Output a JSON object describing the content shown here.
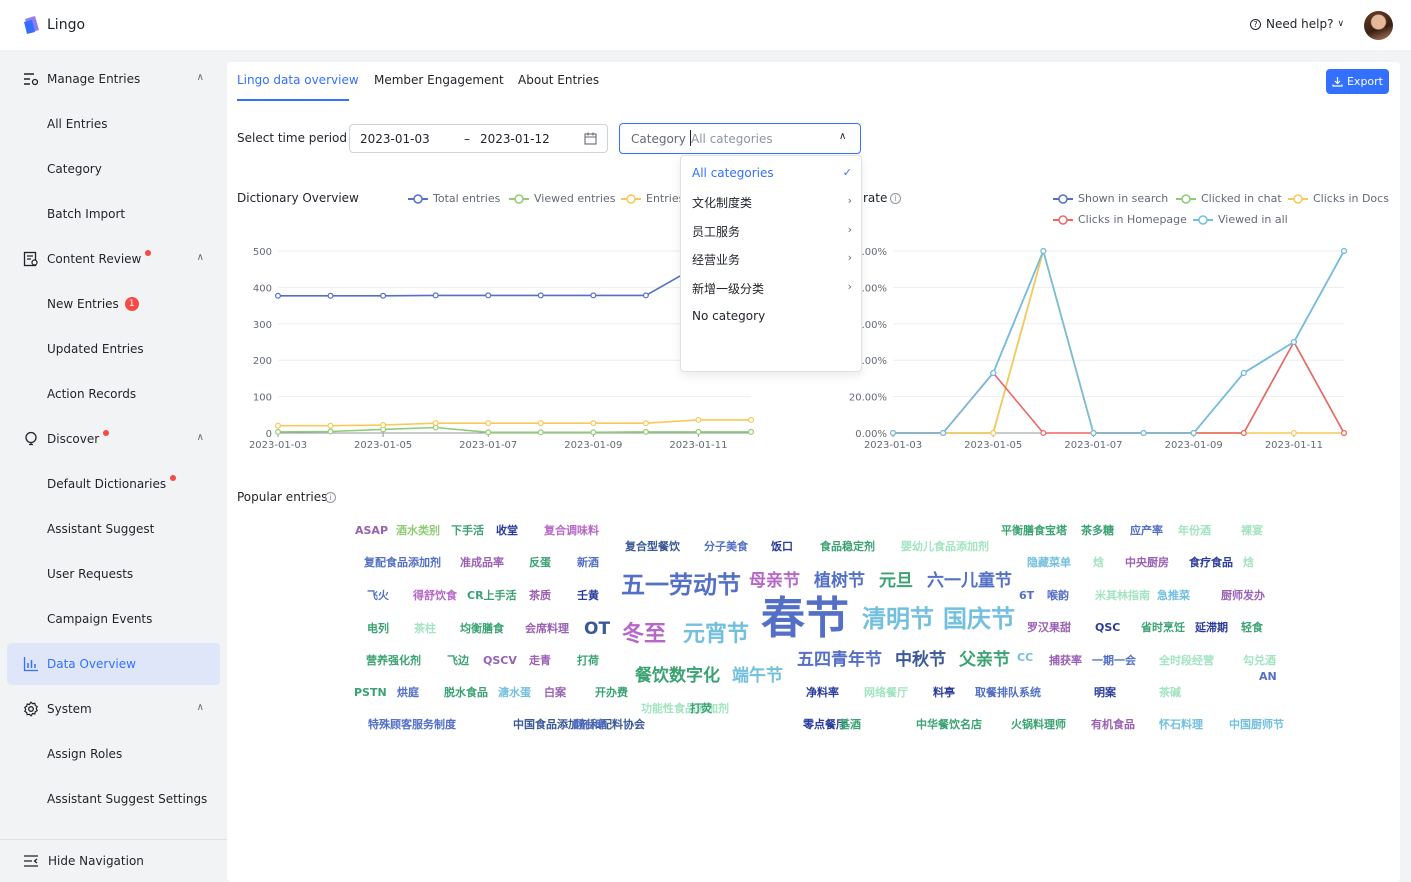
{
  "app": {
    "name": "Lingo",
    "help": "Need help?",
    "avatar": "user-avatar"
  },
  "sidebar": {
    "groups": [
      {
        "label": "Manage Entries",
        "icon": "list-settings-icon",
        "items": [
          "All Entries",
          "Category",
          "Batch Import"
        ]
      },
      {
        "label": "Content Review",
        "icon": "review-icon",
        "items": [
          "New Entries",
          "Updated Entries",
          "Action Records"
        ],
        "new_badge": "1"
      },
      {
        "label": "Discover",
        "icon": "bulb-icon",
        "items": [
          "Default Dictionaries",
          "Assistant Suggest",
          "User Requests",
          "Campaign Events",
          "Data Overview"
        ]
      },
      {
        "label": "System",
        "icon": "gear-icon",
        "items": [
          "Assign Roles",
          "Assistant Suggest Settings"
        ]
      }
    ],
    "hide_nav": "Hide Navigation"
  },
  "tabs": [
    "Lingo data overview",
    "Member Engagement",
    "About Entries"
  ],
  "export_label": "Export",
  "filters": {
    "time_label": "Select time period",
    "start_date": "2023-01-03",
    "end_date": "2023-01-12",
    "date_sep": "–",
    "category_label": "Category",
    "category_placeholder": "All categories"
  },
  "dropdown": {
    "options": [
      "All categories",
      "文化制度类",
      "员工服务",
      "经营业务",
      "新增一级分类",
      "No category"
    ]
  },
  "dictionary_chart": {
    "title": "Dictionary Overview",
    "legend": [
      "Total entries",
      "Viewed entries",
      "Entries"
    ]
  },
  "rate_chart": {
    "title_fragment": "rate",
    "legend": [
      "Shown in search",
      "Clicked in chat",
      "Clicks in Docs",
      "Clicks in Homepage",
      "Viewed in all"
    ]
  },
  "popular": {
    "title": "Popular entries"
  },
  "chart_data": [
    {
      "type": "line",
      "title": "Dictionary Overview",
      "x": [
        "2023-01-03",
        "2023-01-04",
        "2023-01-05",
        "2023-01-06",
        "2023-01-07",
        "2023-01-08",
        "2023-01-09",
        "2023-01-10",
        "2023-01-11",
        "2023-01-12"
      ],
      "x_ticks": [
        "2023-01-03",
        "2023-01-05",
        "2023-01-07",
        "2023-01-09",
        "2023-01-11"
      ],
      "y_ticks": [
        "0",
        "100",
        "200",
        "300",
        "400",
        "500"
      ],
      "ylim": [
        0,
        500
      ],
      "series": [
        {
          "name": "Total entries",
          "color": "#5470c6",
          "values": [
            377,
            377,
            377,
            378,
            378,
            378,
            378,
            378,
            460,
            null
          ]
        },
        {
          "name": "Viewed entries",
          "color": "#91cc75",
          "values": [
            3,
            4,
            10,
            15,
            2,
            2,
            2,
            3,
            3,
            3
          ]
        },
        {
          "name": "Entries",
          "color": "#fac858",
          "values": [
            20,
            20,
            22,
            27,
            27,
            27,
            27,
            27,
            36,
            36
          ]
        }
      ]
    },
    {
      "type": "line",
      "title": "rate",
      "x": [
        "2023-01-03",
        "2023-01-04",
        "2023-01-05",
        "2023-01-06",
        "2023-01-07",
        "2023-01-08",
        "2023-01-09",
        "2023-01-10",
        "2023-01-11",
        "2023-01-12"
      ],
      "x_ticks": [
        "2023-01-03",
        "2023-01-05",
        "2023-01-07",
        "2023-01-09",
        "2023-01-11"
      ],
      "y_ticks": [
        "0.00%",
        "20.00%",
        "40.00%",
        "60.00%",
        "80.00%",
        "100.00%"
      ],
      "ylim": [
        0,
        100
      ],
      "series": [
        {
          "name": "Shown in search",
          "color": "#5470c6",
          "values": [
            0,
            0,
            33,
            100,
            0,
            0,
            0,
            33,
            50,
            100
          ]
        },
        {
          "name": "Clicked in chat",
          "color": "#91cc75",
          "values": [
            0,
            0,
            0,
            100,
            0,
            0,
            0,
            0,
            50,
            0
          ]
        },
        {
          "name": "Clicks in Docs",
          "color": "#fac858",
          "values": [
            0,
            0,
            0,
            100,
            0,
            0,
            0,
            0,
            0,
            0
          ]
        },
        {
          "name": "Clicks in Homepage",
          "color": "#ee6666",
          "values": [
            0,
            0,
            33,
            0,
            0,
            0,
            0,
            0,
            50,
            0
          ]
        },
        {
          "name": "Viewed in all",
          "color": "#73c0de",
          "values": [
            0,
            0,
            33,
            100,
            0,
            0,
            0,
            33,
            50,
            100
          ]
        }
      ]
    }
  ],
  "words": [
    [
      "ASAP",
      "#9a60b4"
    ],
    [
      "酒水类别",
      "#91cc75"
    ],
    [
      "下手活",
      "#3ba272"
    ],
    [
      "收堂",
      "#2b3b9c"
    ],
    [
      "复合调味料",
      "#b667c8"
    ],
    [
      "复合型餐饮",
      "#3b5998"
    ],
    [
      "分子美食",
      "#5470c6"
    ],
    [
      "饭口",
      "#2b3b9c"
    ],
    [
      "食品稳定剂",
      "#3ba272"
    ],
    [
      "婴幼儿食品添加剂",
      "#a3e4c1"
    ],
    [
      "平衡膳食宝塔",
      "#3ba272"
    ],
    [
      "茶多糖",
      "#3ba272"
    ],
    [
      "应产率",
      "#5470c6"
    ],
    [
      "年份酒",
      "#a3e4c1"
    ],
    [
      "裸宴",
      "#a3e4c1"
    ],
    [
      "复配食品添加剂",
      "#5470c6"
    ],
    [
      "准成品率",
      "#9a60b4"
    ],
    [
      "反蛋",
      "#3ba272"
    ],
    [
      "新酒",
      "#5470c6"
    ],
    [
      "隐藏菜单",
      "#73c0de"
    ],
    [
      "焓",
      "#a3e4c1"
    ],
    [
      "中央厨房",
      "#9a60b4"
    ],
    [
      "食疗食品",
      "#2b3b9c"
    ],
    [
      "焓",
      "#a3e4c1"
    ],
    [
      "五一劳动节",
      "#5470c6"
    ],
    [
      "母亲节",
      "#b667c8"
    ],
    [
      "植树节",
      "#5470c6"
    ],
    [
      "元旦",
      "#3ba272"
    ],
    [
      "六一儿童节",
      "#5470c6"
    ],
    [
      "飞火",
      "#5470c6"
    ],
    [
      "得舒饮食",
      "#b667c8"
    ],
    [
      "CR上手活",
      "#3ba272"
    ],
    [
      "茶质",
      "#9a60b4"
    ],
    [
      "壬黄",
      "#2b3b9c"
    ],
    [
      "6T",
      "#5470c6"
    ],
    [
      "喉韵",
      "#5470c6"
    ],
    [
      "米其林指南",
      "#a3e4c1"
    ],
    [
      "急推菜",
      "#73c0de"
    ],
    [
      "厨师发办",
      "#9a60b4"
    ],
    [
      "春节",
      "#5470c6"
    ],
    [
      "清明节",
      "#73c0de"
    ],
    [
      "国庆节",
      "#73c0de"
    ],
    [
      "冬至",
      "#b667c8"
    ],
    [
      "元宵节",
      "#73c0de"
    ],
    [
      "OT",
      "#3b5998"
    ],
    [
      "电列",
      "#3ba272"
    ],
    [
      "茶柱",
      "#a3e4c1"
    ],
    [
      "均衡膳食",
      "#3ba272"
    ],
    [
      "会席料理",
      "#9a60b4"
    ],
    [
      "罗汉果甜",
      "#9a60b4"
    ],
    [
      "QSC",
      "#2b3b9c"
    ],
    [
      "省时烹饪",
      "#3ba272"
    ],
    [
      "延滞期",
      "#2b3b9c"
    ],
    [
      "轻食",
      "#3ba272"
    ],
    [
      "营养强化剂",
      "#3ba272"
    ],
    [
      "飞边",
      "#3ba272"
    ],
    [
      "QSCV",
      "#9a60b4"
    ],
    [
      "走青",
      "#9a60b4"
    ],
    [
      "打荷",
      "#3ba272"
    ],
    [
      "五四青年节",
      "#5470c6"
    ],
    [
      "中秋节",
      "#3b5998"
    ],
    [
      "父亲节",
      "#3ba272"
    ],
    [
      "CC",
      "#73c0de"
    ],
    [
      "捕获率",
      "#9a60b4"
    ],
    [
      "一期一会",
      "#5470c6"
    ],
    [
      "全时段经营",
      "#a3e4c1"
    ],
    [
      "勾兑酒",
      "#a3e4c1"
    ],
    [
      "餐饮数字化",
      "#3ba272"
    ],
    [
      "端午节",
      "#73c0de"
    ],
    [
      "AN",
      "#5470c6"
    ],
    [
      "PSTN",
      "#3ba272"
    ],
    [
      "烘庭",
      "#5470c6"
    ],
    [
      "脱水食品",
      "#3ba272"
    ],
    [
      "溏水蛋",
      "#73c0de"
    ],
    [
      "白案",
      "#9a60b4"
    ],
    [
      "开办费",
      "#3ba272"
    ],
    [
      "净料率",
      "#2b3b9c"
    ],
    [
      "网络餐厅",
      "#a3e4c1"
    ],
    [
      "料亭",
      "#2b3b9c"
    ],
    [
      "取餐排队系统",
      "#5470c6"
    ],
    [
      "明案",
      "#2b3b9c"
    ],
    [
      "茶碱",
      "#a3e4c1"
    ],
    [
      "功能性食品添加剂",
      "#a3e4c1"
    ],
    [
      "打荧",
      "#3ba272"
    ],
    [
      "特殊顾客服务制度",
      "#5470c6"
    ],
    [
      "中国食品添加剂和配料协会",
      "#3b5998"
    ],
    [
      "翻台率",
      "#5470c6"
    ],
    [
      "零点餐厅",
      "#2b3b9c"
    ],
    [
      "基酒",
      "#3ba272"
    ],
    [
      "中华餐饮名店",
      "#3ba272"
    ],
    [
      "火锅料理师",
      "#3ba272"
    ],
    [
      "有机食品",
      "#9a60b4"
    ],
    [
      "怀石料理",
      "#73c0de"
    ],
    [
      "中国厨师节",
      "#73c0de"
    ],
    [
      "水台",
      "#73c0de"
    ]
  ]
}
